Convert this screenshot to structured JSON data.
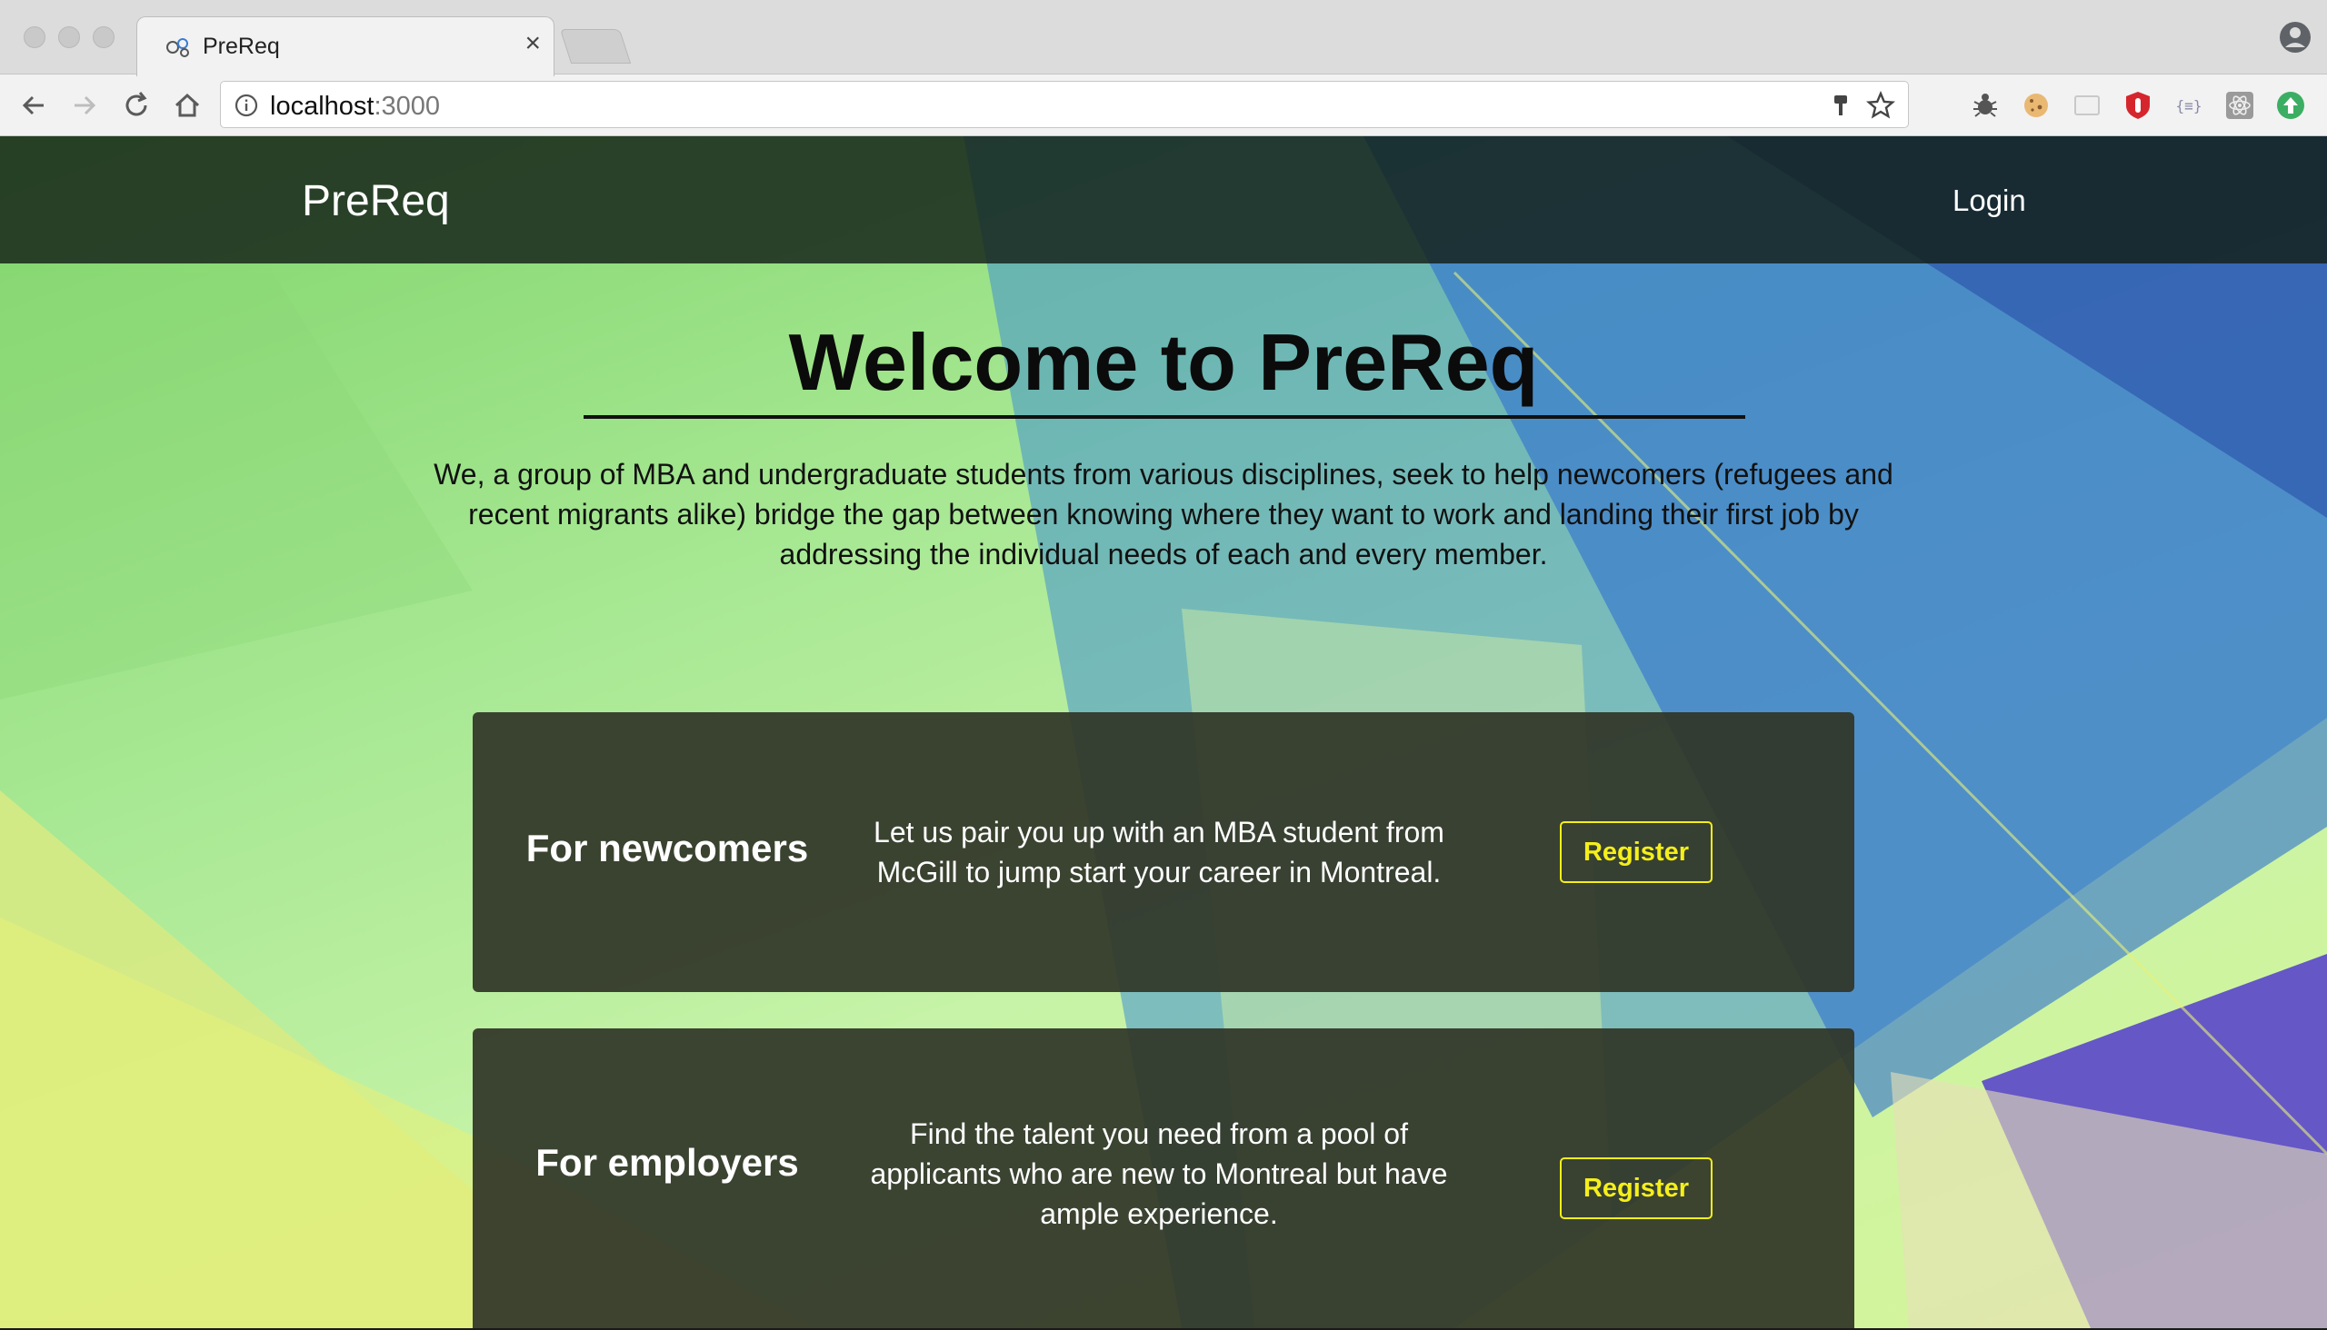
{
  "browser": {
    "tab_title": "PreReq",
    "tab_close": "×",
    "url_host": "localhost",
    "url_port": ":3000"
  },
  "navbar": {
    "brand": "PreReq",
    "login": "Login"
  },
  "hero": {
    "title": "Welcome to PreReq",
    "description": "We, a group of MBA and undergraduate students from various disciplines, seek to help newcomers (refugees and recent migrants alike) bridge the gap between knowing where they want to work and landing their first job by addressing the individual needs of each and every member."
  },
  "cards": [
    {
      "title": "For newcomers",
      "text": "Let us pair you up with an MBA student from McGill to jump start your career in Montreal.",
      "button": "Register"
    },
    {
      "title": "For employers",
      "text": "Find the talent you need from a pool of applicants who are new to Montreal but have ample experience.",
      "button": "Register"
    }
  ],
  "colors": {
    "accent_yellow": "#f5ef1a",
    "navbar_bg": "#121e16",
    "card_bg": "#303628"
  }
}
